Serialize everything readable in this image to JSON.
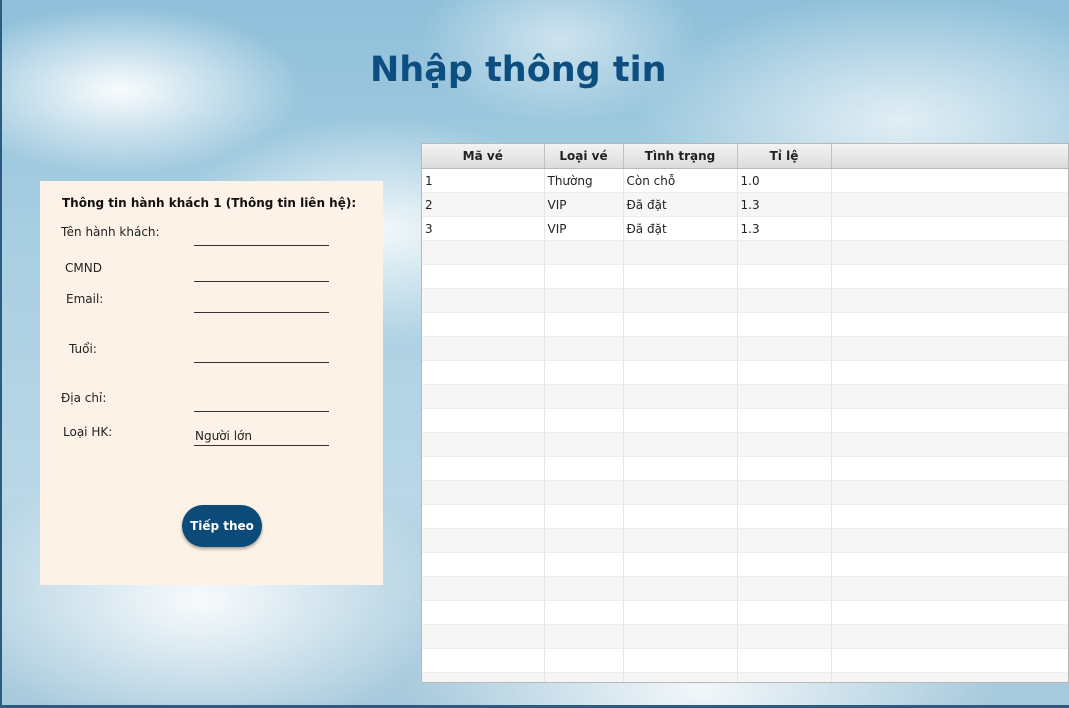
{
  "page": {
    "title": "Nhập thông tin"
  },
  "form": {
    "heading": "Thông tin hành khách 1 (Thông tin liên hệ):",
    "name_label": "Tên hành khách:",
    "name_value": "",
    "id_label": "CMND",
    "id_value": "",
    "email_label": "Email:",
    "email_value": "",
    "age_label": "Tuổi:",
    "age_value": "",
    "address_label": "Địa chỉ:",
    "address_value": "",
    "type_label": "Loại HK:",
    "type_value": "Người lớn",
    "next_label": "Tiếp theo"
  },
  "table": {
    "headers": [
      "Mã vé",
      "Loại vé",
      "Tình trạng",
      "Tỉ lệ",
      ""
    ],
    "rows": [
      [
        "1",
        "Thường",
        "Còn chỗ",
        "1.0",
        ""
      ],
      [
        "2",
        "VIP",
        "Đã đặt",
        "1.3",
        ""
      ],
      [
        "3",
        "VIP",
        "Đã đặt",
        "1.3",
        ""
      ]
    ]
  },
  "colors": {
    "accent": "#0c4a7a",
    "title": "#0d4e80",
    "panel": "#fdf2e7"
  }
}
